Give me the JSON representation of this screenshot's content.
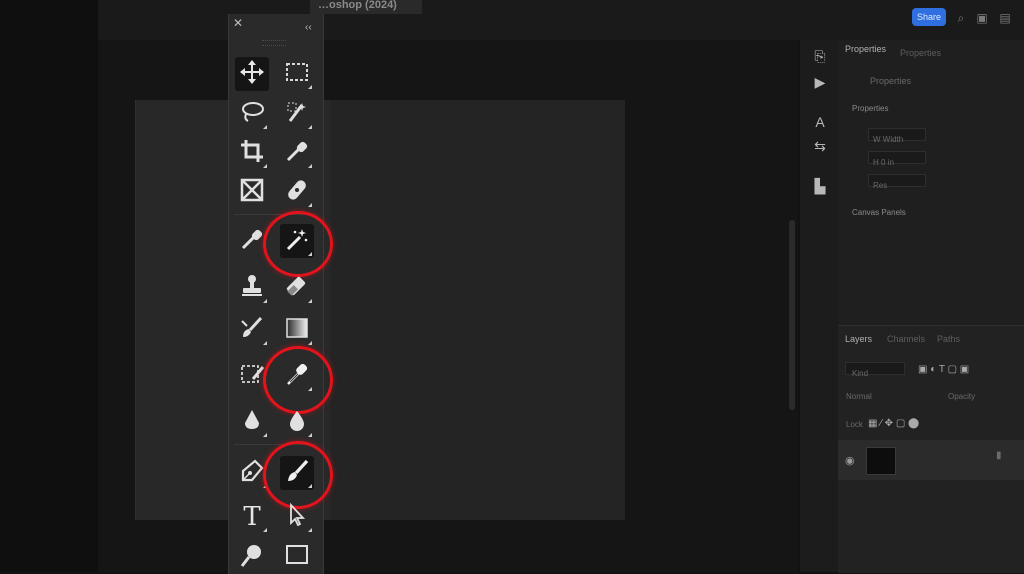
{
  "app": {
    "document_tab": "…oshop (2024)",
    "share_label": "Share"
  },
  "colors": {
    "highlight_ring": "#e3131b",
    "share_button": "#2f6fe0",
    "toolbar_bg": "#2a2a2a"
  },
  "toolbar": {
    "close_glyph": "✕",
    "collapse_glyph": "‹‹",
    "tools": [
      {
        "name": "move-tool",
        "icon": "move-icon"
      },
      {
        "name": "rectangular-marquee-tool",
        "icon": "marquee-icon"
      },
      {
        "name": "lasso-tool",
        "icon": "lasso-icon"
      },
      {
        "name": "object-selection-tool",
        "icon": "object-select-icon"
      },
      {
        "name": "crop-tool",
        "icon": "crop-icon"
      },
      {
        "name": "eyedropper-tool",
        "icon": "eyedropper-icon"
      },
      {
        "name": "frame-tool",
        "icon": "frame-icon"
      },
      {
        "name": "spot-healing-tool",
        "icon": "bandage-icon"
      },
      {
        "name": "color-sampler-tool",
        "icon": "eyedropper-icon"
      },
      {
        "name": "magic-wand-tool",
        "icon": "magic-wand-icon"
      },
      {
        "name": "clone-stamp-tool",
        "icon": "stamp-icon"
      },
      {
        "name": "eraser-tool",
        "icon": "eraser-icon"
      },
      {
        "name": "brush-adjust-tool",
        "icon": "brush-icon"
      },
      {
        "name": "gradient-tool",
        "icon": "gradient-icon"
      },
      {
        "name": "quick-selection-tool",
        "icon": "dashed-brush-icon"
      },
      {
        "name": "eyedropper-highlighted-tool",
        "icon": "eyedropper-icon"
      },
      {
        "name": "sharpen-tool",
        "icon": "sharpen-icon"
      },
      {
        "name": "blur-tool",
        "icon": "drop-icon"
      },
      {
        "name": "pen-tool",
        "icon": "pen-icon"
      },
      {
        "name": "brush-tool",
        "icon": "brush-icon"
      },
      {
        "name": "type-tool",
        "icon": "type-icon"
      },
      {
        "name": "path-selection-tool",
        "icon": "arrow-icon"
      },
      {
        "name": "dodge-tool",
        "icon": "dodge-icon"
      },
      {
        "name": "rectangle-tool",
        "icon": "rectangle-icon"
      }
    ],
    "type_glyph": "T"
  },
  "properties_panel": {
    "tab_properties": "Properties",
    "tab_adjustments": "Properties",
    "section_label": "Properties",
    "doc_label": "Properties",
    "field_w": "W  Width",
    "field_h": "H  0 in",
    "field_res": "Res",
    "section_canvas": "Canvas Panels"
  },
  "layers_panel": {
    "tab_layers": "Layers",
    "tab_channels": "Channels",
    "tab_paths": "Paths",
    "filter_label": "Kind",
    "blend_mode": "Normal",
    "opacity_label": "Opacity",
    "lock_label": "Lock"
  }
}
